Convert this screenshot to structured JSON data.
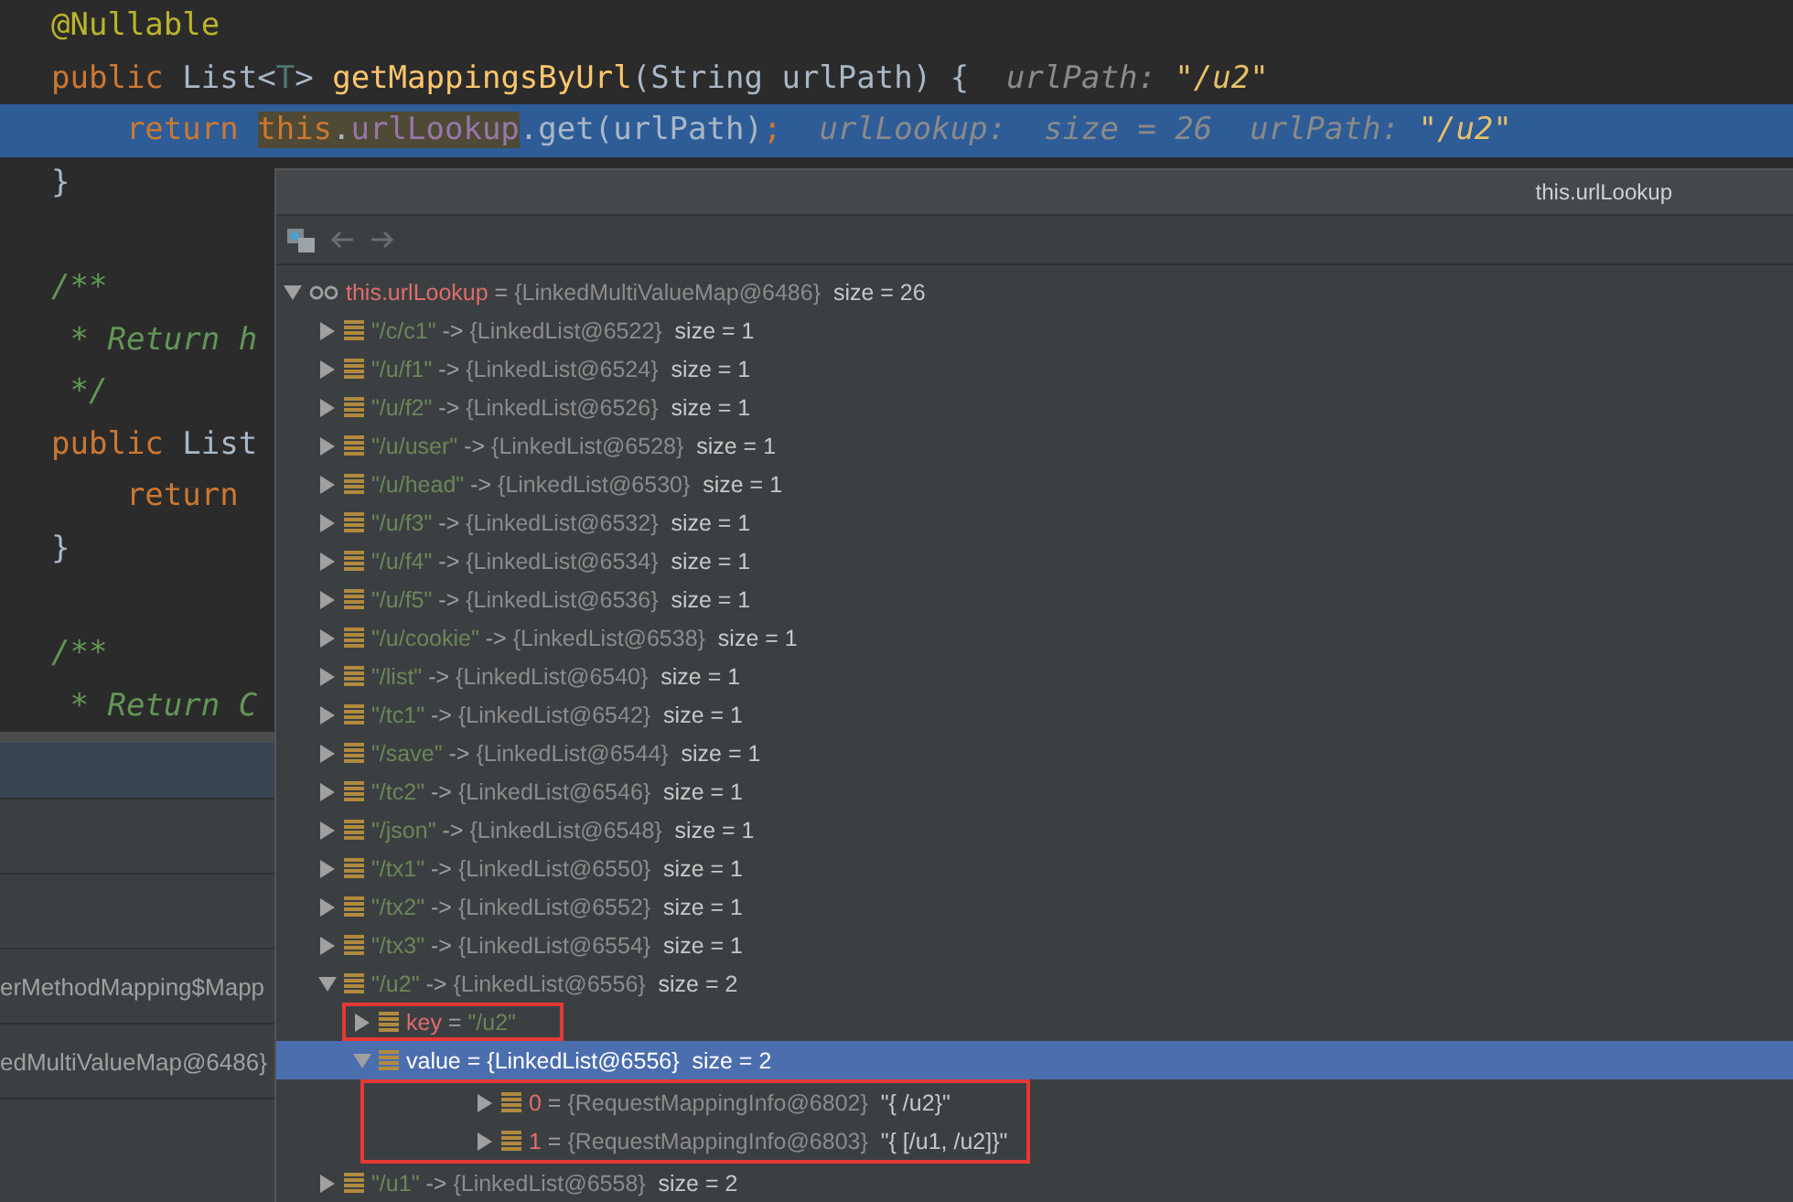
{
  "editor": {
    "lines": [
      {
        "selected": false,
        "tokens": [
          {
            "text": "@Nullable",
            "kind": "annotation"
          }
        ]
      },
      {
        "selected": false,
        "tokens": [
          {
            "text": "public ",
            "kind": "keyword"
          },
          {
            "text": "List<",
            "kind": "plain"
          },
          {
            "text": "T",
            "kind": "typeparam"
          },
          {
            "text": "> ",
            "kind": "plain"
          },
          {
            "text": "getMappingsByUrl",
            "kind": "method"
          },
          {
            "text": "(String urlPath) {  ",
            "kind": "plain"
          },
          {
            "text": "urlPath: ",
            "kind": "hint"
          },
          {
            "text": "\"/u2\"",
            "kind": "hintvalue"
          }
        ]
      },
      {
        "selected": true,
        "tokens": [
          {
            "text": "    return ",
            "kind": "keyword"
          },
          {
            "text": "this",
            "kind": "keyword",
            "highlight": true
          },
          {
            "text": ".",
            "kind": "plain",
            "highlight": true
          },
          {
            "text": "urlLookup",
            "kind": "field",
            "highlight": true
          },
          {
            "text": ".get(urlPath)",
            "kind": "plain"
          },
          {
            "text": ";  ",
            "kind": "keyword"
          },
          {
            "text": "urlLookup:  size = 26  urlPath: ",
            "kind": "hint"
          },
          {
            "text": "\"/u2\"",
            "kind": "hintvalue"
          }
        ]
      },
      {
        "selected": false,
        "tokens": [
          {
            "text": "}",
            "kind": "plain"
          }
        ]
      },
      {
        "selected": false
      },
      {
        "selected": false,
        "tokens": [
          {
            "text": "/**",
            "kind": "comment"
          }
        ]
      },
      {
        "selected": false,
        "tokens": [
          {
            "text": " * Return h",
            "kind": "comment"
          }
        ]
      },
      {
        "selected": false,
        "tokens": [
          {
            "text": " */",
            "kind": "comment"
          }
        ]
      },
      {
        "selected": false,
        "tokens": [
          {
            "text": "public ",
            "kind": "keyword"
          },
          {
            "text": "List",
            "kind": "plain"
          }
        ]
      },
      {
        "selected": false,
        "tokens": [
          {
            "text": "    return",
            "kind": "keyword"
          }
        ]
      },
      {
        "selected": false,
        "tokens": [
          {
            "text": "}",
            "kind": "plain"
          }
        ]
      },
      {
        "selected": false
      },
      {
        "selected": false,
        "tokens": [
          {
            "text": "/**",
            "kind": "comment"
          }
        ]
      },
      {
        "selected": false,
        "tokens": [
          {
            "text": " * Return C",
            "kind": "comment"
          }
        ]
      }
    ]
  },
  "debug_panel": {
    "rows": [
      {
        "selected": true
      },
      {
        "selected": false
      },
      {
        "selected": false
      },
      {
        "text": "erMethodMapping$Mapp",
        "selected": false
      },
      {
        "text": "edMultiValueMap@6486}",
        "selected": false
      }
    ]
  },
  "popup": {
    "title": "this.urlLookup",
    "tree": [
      {
        "name": "this.urlLookup",
        "kind": "watch",
        "operator": "=",
        "value": "{LinkedMultiValueMap@6486}",
        "extra": "size = 26",
        "expanded": true,
        "selected": false,
        "children": [
          {
            "name": "\"/c/c1\"",
            "kind": "key",
            "operator": "->",
            "value": "{LinkedList@6522}",
            "extra": "size = 1",
            "expanded": false,
            "selected": false
          },
          {
            "name": "\"/u/f1\"",
            "kind": "key",
            "operator": "->",
            "value": "{LinkedList@6524}",
            "extra": "size = 1",
            "expanded": false,
            "selected": false
          },
          {
            "name": "\"/u/f2\"",
            "kind": "key",
            "operator": "->",
            "value": "{LinkedList@6526}",
            "extra": "size = 1",
            "expanded": false,
            "selected": false
          },
          {
            "name": "\"/u/user\"",
            "kind": "key",
            "operator": "->",
            "value": "{LinkedList@6528}",
            "extra": "size = 1",
            "expanded": false,
            "selected": false
          },
          {
            "name": "\"/u/head\"",
            "kind": "key",
            "operator": "->",
            "value": "{LinkedList@6530}",
            "extra": "size = 1",
            "expanded": false,
            "selected": false
          },
          {
            "name": "\"/u/f3\"",
            "kind": "key",
            "operator": "->",
            "value": "{LinkedList@6532}",
            "extra": "size = 1",
            "expanded": false,
            "selected": false
          },
          {
            "name": "\"/u/f4\"",
            "kind": "key",
            "operator": "->",
            "value": "{LinkedList@6534}",
            "extra": "size = 1",
            "expanded": false,
            "selected": false
          },
          {
            "name": "\"/u/f5\"",
            "kind": "key",
            "operator": "->",
            "value": "{LinkedList@6536}",
            "extra": "size = 1",
            "expanded": false,
            "selected": false
          },
          {
            "name": "\"/u/cookie\"",
            "kind": "key",
            "operator": "->",
            "value": "{LinkedList@6538}",
            "extra": "size = 1",
            "expanded": false,
            "selected": false
          },
          {
            "name": "\"/list\"",
            "kind": "key",
            "operator": "->",
            "value": "{LinkedList@6540}",
            "extra": "size = 1",
            "expanded": false,
            "selected": false
          },
          {
            "name": "\"/tc1\"",
            "kind": "key",
            "operator": "->",
            "value": "{LinkedList@6542}",
            "extra": "size = 1",
            "expanded": false,
            "selected": false
          },
          {
            "name": "\"/save\"",
            "kind": "key",
            "operator": "->",
            "value": "{LinkedList@6544}",
            "extra": "size = 1",
            "expanded": false,
            "selected": false
          },
          {
            "name": "\"/tc2\"",
            "kind": "key",
            "operator": "->",
            "value": "{LinkedList@6546}",
            "extra": "size = 1",
            "expanded": false,
            "selected": false
          },
          {
            "name": "\"/json\"",
            "kind": "key",
            "operator": "->",
            "value": "{LinkedList@6548}",
            "extra": "size = 1",
            "expanded": false,
            "selected": false
          },
          {
            "name": "\"/tx1\"",
            "kind": "key",
            "operator": "->",
            "value": "{LinkedList@6550}",
            "extra": "size = 1",
            "expanded": false,
            "selected": false
          },
          {
            "name": "\"/tx2\"",
            "kind": "key",
            "operator": "->",
            "value": "{LinkedList@6552}",
            "extra": "size = 1",
            "expanded": false,
            "selected": false
          },
          {
            "name": "\"/tx3\"",
            "kind": "key",
            "operator": "->",
            "value": "{LinkedList@6554}",
            "extra": "size = 1",
            "expanded": false,
            "selected": false
          },
          {
            "name": "\"/u2\"",
            "kind": "key",
            "operator": "->",
            "value": "{LinkedList@6556}",
            "extra": "size = 2",
            "expanded": true,
            "selected": false,
            "children": [
              {
                "name": "key",
                "kind": "string_field",
                "operator": "=",
                "value": "\"/u2\"",
                "expanded": false,
                "selected": false,
                "boxed": true
              },
              {
                "name": "value",
                "kind": "field",
                "operator": "=",
                "value": "{LinkedList@6556}",
                "extra": "size = 2",
                "expanded": true,
                "selected": true,
                "children_boxed": true,
                "children": [
                  {
                    "name": "0",
                    "kind": "field",
                    "operator": "=",
                    "value": "{RequestMappingInfo@6802}",
                    "extra": "\"{ /u2}\"",
                    "expanded": false,
                    "selected": false
                  },
                  {
                    "name": "1",
                    "kind": "field",
                    "operator": "=",
                    "value": "{RequestMappingInfo@6803}",
                    "extra": "\"{ [/u1, /u2]}\"",
                    "expanded": false,
                    "selected": false
                  }
                ]
              }
            ]
          },
          {
            "name": "\"/u1\"",
            "kind": "key",
            "operator": "->",
            "value": "{LinkedList@6558}",
            "extra": "size = 2",
            "expanded": false,
            "selected": false
          }
        ]
      }
    ]
  }
}
